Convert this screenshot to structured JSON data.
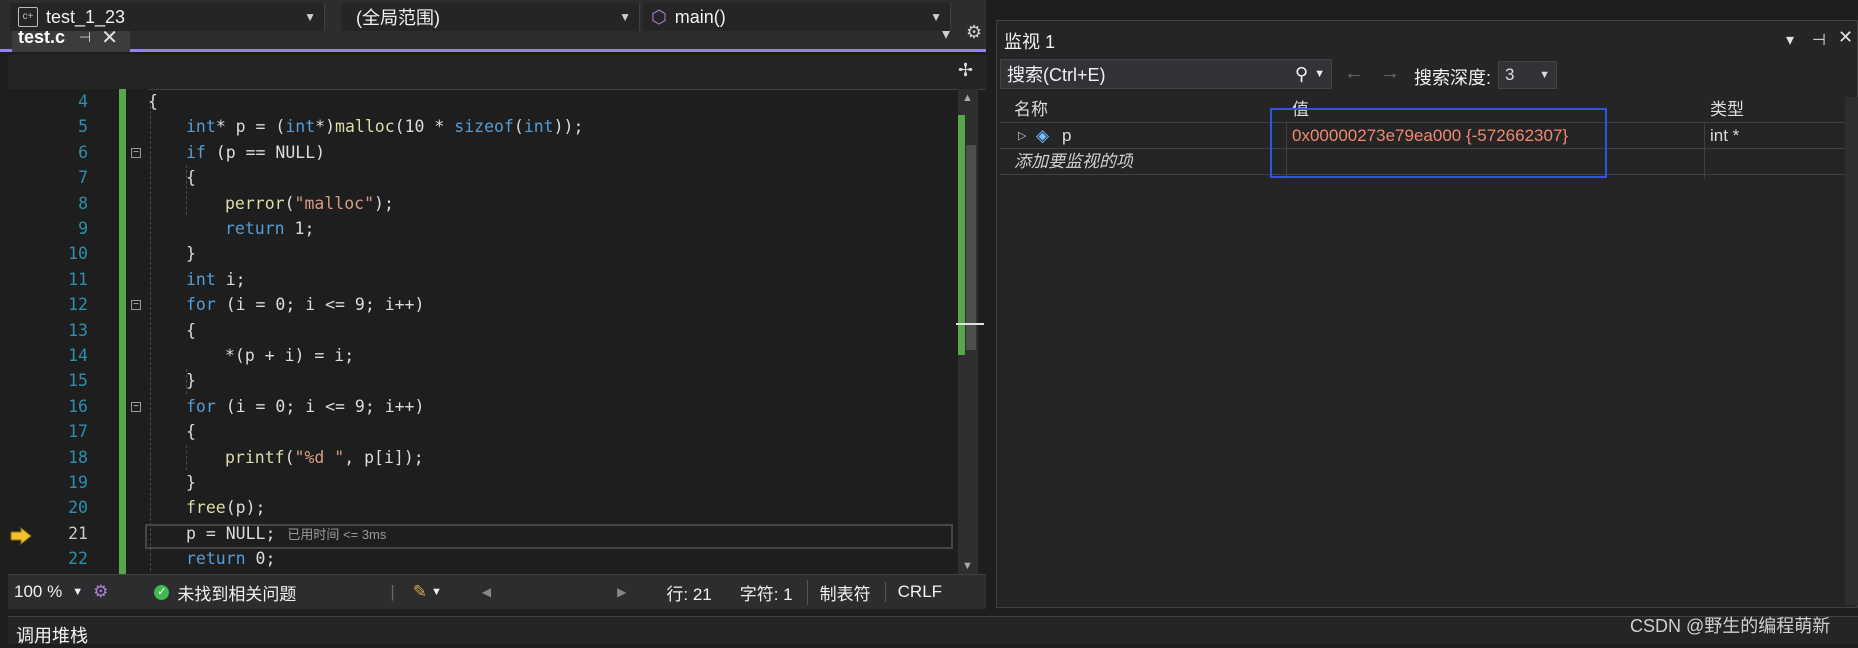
{
  "editor": {
    "tab": {
      "name": "test.c",
      "pin_icon": "pin-icon",
      "close_icon": "close-icon"
    },
    "nav": {
      "project": "test_1_23",
      "scope": "(全局范围)",
      "member": "main()"
    },
    "lines": [
      {
        "num": "4"
      },
      {
        "num": "5"
      },
      {
        "num": "6"
      },
      {
        "num": "7"
      },
      {
        "num": "8"
      },
      {
        "num": "9"
      },
      {
        "num": "10"
      },
      {
        "num": "11"
      },
      {
        "num": "12"
      },
      {
        "num": "13"
      },
      {
        "num": "14"
      },
      {
        "num": "15"
      },
      {
        "num": "16"
      },
      {
        "num": "17"
      },
      {
        "num": "18"
      },
      {
        "num": "19"
      },
      {
        "num": "20"
      },
      {
        "num": "21"
      },
      {
        "num": "22"
      }
    ],
    "code": {
      "l4": "{",
      "l5_type": "int",
      "l5_a": "* p = (",
      "l5_cast": "int",
      "l5_b": "*)",
      "l5_fn": "malloc",
      "l5_c": "(10 * ",
      "l5_kw": "sizeof",
      "l5_d": "(",
      "l5_int2": "int",
      "l5_e": "));",
      "l6_kw": "if",
      "l6_rest": " (p == NULL)",
      "l7": "{",
      "l8_fn": "perror",
      "l8_a": "(",
      "l8_str": "\"malloc\"",
      "l8_b": ");",
      "l9_kw": "return",
      "l9_rest": " 1;",
      "l10": "}",
      "l11_kw": "int",
      "l11_rest": " i;",
      "l12_kw": "for",
      "l12_rest": " (i = 0; i <= 9; i++)",
      "l13": "{",
      "l14": "*(p + i) = i;",
      "l15": "}",
      "l16_kw": "for",
      "l16_rest": " (i = 0; i <= 9; i++)",
      "l17": "{",
      "l18_fn": "printf",
      "l18_a": "(",
      "l18_str": "\"%d \"",
      "l18_b": ", p[i]);",
      "l19": "}",
      "l20_fn": "free",
      "l20_rest": "(p);",
      "l21": "p = NULL;",
      "l21_hint": "已用时间 <= 3ms",
      "l22_kw": "return",
      "l22_rest": " 0;"
    },
    "status": {
      "zoom": "100 %",
      "issues": "未找到相关问题",
      "line": "行: 21",
      "char": "字符: 1",
      "tabs": "制表符",
      "eol": "CRLF"
    }
  },
  "watch": {
    "title": "监视 1",
    "search_placeholder": "搜索(Ctrl+E)",
    "depth_label": "搜索深度:",
    "depth_value": "3",
    "columns": {
      "name": "名称",
      "value": "值",
      "type": "类型"
    },
    "rows": [
      {
        "name": "p",
        "value": "0x00000273e79ea000 {-572662307}",
        "type": "int *"
      }
    ],
    "add_item": "添加要监视的项"
  },
  "bottom_panel": {
    "title": "调用堆栈"
  },
  "watermark": "CSDN @野生的编程萌新",
  "colors": {
    "accent": "#9184ee",
    "keyword": "#569cd6",
    "function": "#dcdcaa",
    "string": "#d69d85",
    "value_changed": "#f48771",
    "change_bar": "#57a64a",
    "highlight_box": "#3355dd"
  }
}
